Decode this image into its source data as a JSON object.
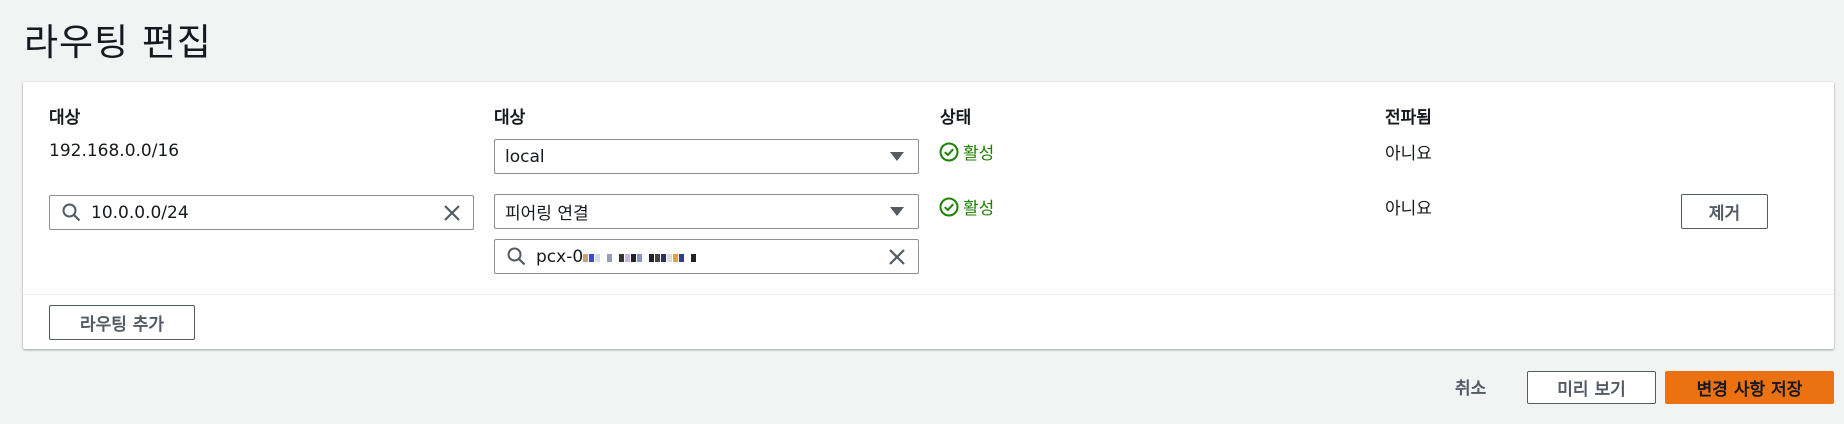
{
  "page": {
    "title": "라우팅 편집"
  },
  "columns": {
    "destination": "대상",
    "target": "대상",
    "status": "상태",
    "propagated": "전파됨"
  },
  "routes": [
    {
      "destination": "192.168.0.0/16",
      "target": "local",
      "status": "활성",
      "propagated": "아니요"
    },
    {
      "destination": "10.0.0.0/24",
      "target": "피어링 연결",
      "target_id": "pcx-0",
      "status": "활성",
      "propagated": "아니요",
      "remove_label": "제거"
    }
  ],
  "add_route_label": "라우팅 추가",
  "footer": {
    "cancel_label": "취소",
    "preview_label": "미리 보기",
    "save_label": "변경 사항 저장"
  },
  "colors": {
    "status_active": "#1d8102",
    "primary": "#ec7211",
    "background": "#f2f3f3"
  },
  "icons": {
    "search": "search-icon",
    "clear": "close-icon",
    "caret": "caret-down-icon",
    "status": "check-circle-icon"
  }
}
